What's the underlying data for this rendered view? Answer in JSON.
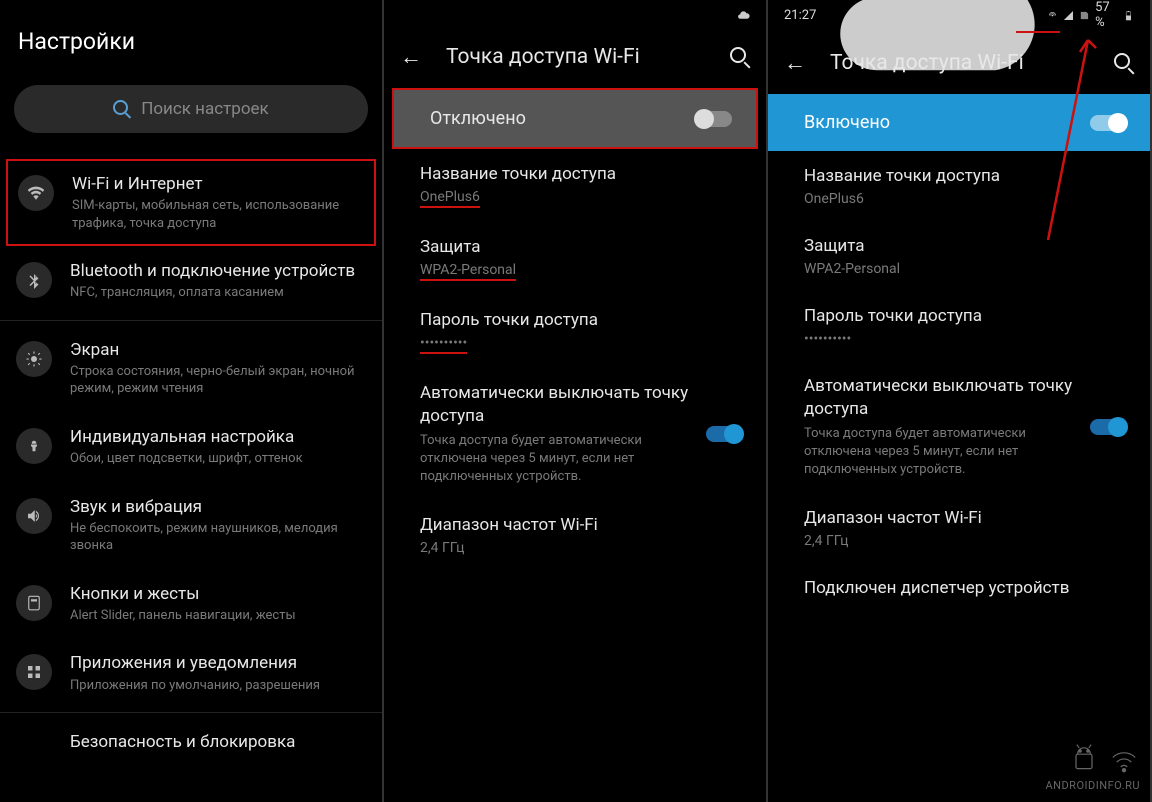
{
  "panel1": {
    "title": "Настройки",
    "search_placeholder": "Поиск настроек",
    "items": [
      {
        "title": "Wi-Fi и Интернет",
        "sub": "SIM-карты, мобильная сеть, использование трафика, точка доступа"
      },
      {
        "title": "Bluetooth и подключение устройств",
        "sub": "NFC, трансляция, оплата касанием"
      },
      {
        "title": "Экран",
        "sub": "Строка состояния, черно-белый экран, ночной режим, режим чтения"
      },
      {
        "title": "Индивидуальная настройка",
        "sub": "Обои, цвет подсветки, шрифт, оттенок"
      },
      {
        "title": "Звук и вибрация",
        "sub": "Не беспокоить, режим наушников, мелодия звонка"
      },
      {
        "title": "Кнопки и жесты",
        "sub": "Alert Slider, панель навигации, жесты"
      },
      {
        "title": "Приложения и уведомления",
        "sub": "Приложения по умолчанию, разрешения"
      },
      {
        "title": "Безопасность и блокировка",
        "sub": ""
      }
    ]
  },
  "panel2": {
    "header": "Точка доступа Wi-Fi",
    "toggle_label": "Отключено",
    "rows": [
      {
        "title": "Название точки доступа",
        "value": "OnePlus6"
      },
      {
        "title": "Защита",
        "value": "WPA2-Personal"
      },
      {
        "title": "Пароль точки доступа",
        "value": "••••••••••"
      },
      {
        "title": "Автоматически выключать точку доступа",
        "desc": "Точка доступа будет автоматически отключена через 5 минут, если нет подключенных устройств."
      },
      {
        "title": "Диапазон частот Wi-Fi",
        "value": "2,4 ГГц"
      }
    ]
  },
  "panel3": {
    "status_time": "21:27",
    "status_battery": "57 %",
    "header": "Точка доступа Wi-Fi",
    "toggle_label": "Включено",
    "rows": [
      {
        "title": "Название точки доступа",
        "value": "OnePlus6"
      },
      {
        "title": "Защита",
        "value": "WPA2-Personal"
      },
      {
        "title": "Пароль точки доступа",
        "value": "••••••••••"
      },
      {
        "title": "Автоматически выключать точку доступа",
        "desc": "Точка доступа будет автоматически отключена через 5 минут, если нет подключенных устройств."
      },
      {
        "title": "Диапазон частот Wi-Fi",
        "value": "2,4 ГГц"
      },
      {
        "title": "Подключен диспетчер устройств",
        "value": ""
      }
    ]
  },
  "watermark": "ANDROIDINFO.RU"
}
